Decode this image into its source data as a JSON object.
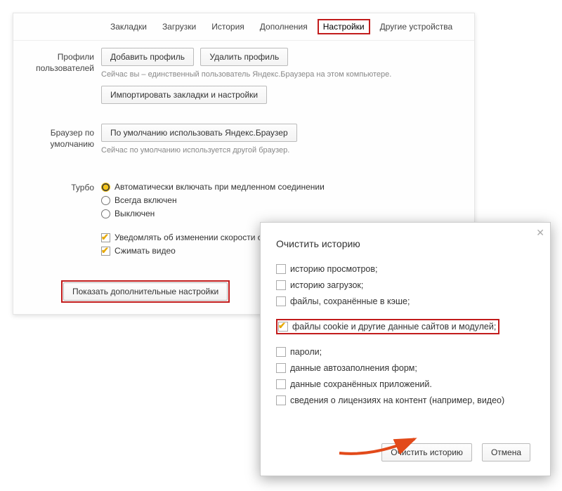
{
  "nav": {
    "items": [
      "Закладки",
      "Загрузки",
      "История",
      "Дополнения",
      "Настройки",
      "Другие устройства"
    ],
    "active_index": 4
  },
  "profiles": {
    "label": "Профили пользователей",
    "add": "Добавить профиль",
    "remove": "Удалить профиль",
    "hint": "Сейчас вы – единственный пользователь Яндекс.Браузера на этом компьютере.",
    "import": "Импортировать закладки и настройки"
  },
  "default_browser": {
    "label": "Браузер по умолчанию",
    "button": "По умолчанию использовать Яндекс.Браузер",
    "hint": "Сейчас по умолчанию используется другой браузер."
  },
  "turbo": {
    "label": "Турбо",
    "radios": [
      "Автоматически включать при медленном соединении",
      "Всегда включен",
      "Выключен"
    ],
    "selected": 0,
    "checks": [
      {
        "label": "Уведомлять об изменении скорости соедине",
        "checked": true
      },
      {
        "label": "Сжимать видео",
        "checked": true
      }
    ]
  },
  "advanced_button": "Показать дополнительные настройки",
  "dialog": {
    "title": "Очистить историю",
    "options": [
      {
        "label": "историю просмотров;",
        "checked": false
      },
      {
        "label": "историю загрузок;",
        "checked": false
      },
      {
        "label": "файлы, сохранённые в кэше;",
        "checked": false
      },
      {
        "label": "файлы cookie и другие данные сайтов и модулей;",
        "checked": true,
        "highlight": true
      },
      {
        "label": "пароли;",
        "checked": false
      },
      {
        "label": "данные автозаполнения форм;",
        "checked": false
      },
      {
        "label": "данные сохранённых приложений.",
        "checked": false
      },
      {
        "label": "сведения о лицензиях на контент (например, видео)",
        "checked": false
      }
    ],
    "clear": "Очистить историю",
    "cancel": "Отмена"
  }
}
